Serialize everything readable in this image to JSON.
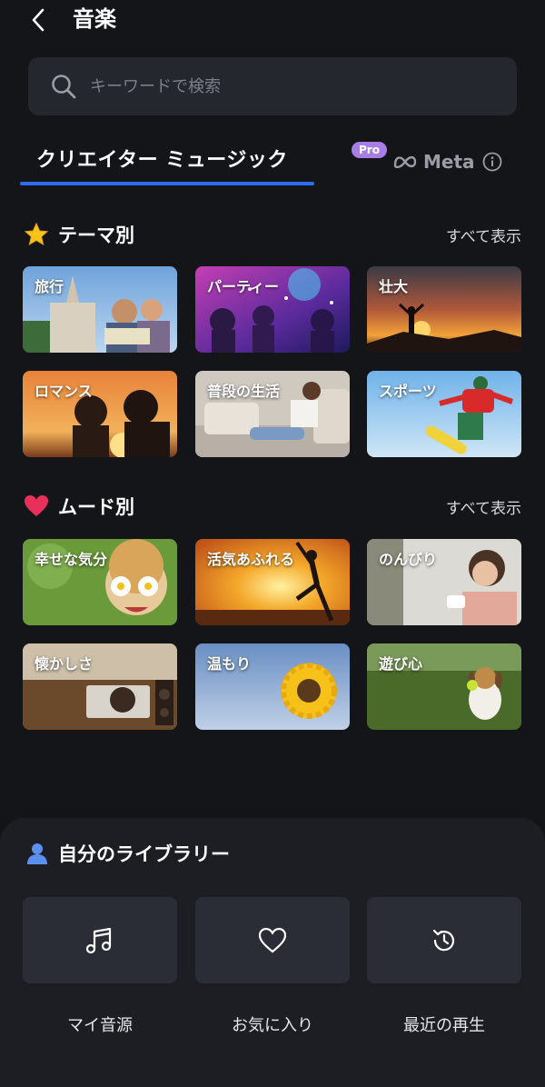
{
  "header": {
    "title": "音楽",
    "back_icon": "back-chevron-icon"
  },
  "search": {
    "placeholder": "キーワードで検索",
    "value": ""
  },
  "tabs": {
    "creator_label": "クリエイター ミュージック",
    "pro_badge": "Pro",
    "meta_label": "Meta",
    "active": "creator"
  },
  "theme_section": {
    "title": "テーマ別",
    "see_all": "すべて表示",
    "icon": "star-icon",
    "cards": [
      {
        "label": "旅行"
      },
      {
        "label": "パーティー"
      },
      {
        "label": "壮大"
      },
      {
        "label": "ロマンス"
      },
      {
        "label": "普段の生活"
      },
      {
        "label": "スポーツ"
      }
    ]
  },
  "mood_section": {
    "title": "ムード別",
    "see_all": "すべて表示",
    "icon": "heart-icon",
    "cards": [
      {
        "label": "幸せな気分"
      },
      {
        "label": "活気あふれる"
      },
      {
        "label": "のんびり"
      },
      {
        "label": "懐かしさ"
      },
      {
        "label": "温もり"
      },
      {
        "label": "遊び心"
      }
    ]
  },
  "library": {
    "title": "自分のライブラリー",
    "icon": "user-icon",
    "items": [
      {
        "label": "マイ音源",
        "icon": "music-note-icon"
      },
      {
        "label": "お気に入り",
        "icon": "heart-outline-icon"
      },
      {
        "label": "最近の再生",
        "icon": "history-icon"
      }
    ]
  },
  "colors": {
    "accent": "#2f6cf0",
    "pro": "#a97de6",
    "background": "#141518",
    "card": "#2a2d35"
  }
}
